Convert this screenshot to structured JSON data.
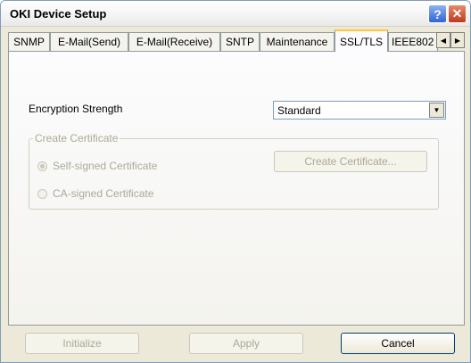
{
  "window": {
    "title": "OKI Device Setup",
    "help_glyph": "?",
    "close_glyph": "✕"
  },
  "tabs": [
    {
      "label": "SNMP",
      "active": false
    },
    {
      "label": "E-Mail(Send)",
      "active": false
    },
    {
      "label": "E-Mail(Receive)",
      "active": false
    },
    {
      "label": "SNTP",
      "active": false
    },
    {
      "label": "Maintenance",
      "active": false
    },
    {
      "label": "SSL/TLS",
      "active": true
    },
    {
      "label": "IEEE802",
      "active": false
    }
  ],
  "tab_scroll": {
    "left_glyph": "◀",
    "right_glyph": "▶"
  },
  "encryption": {
    "label": "Encryption Strength",
    "value": "Standard",
    "arrow_glyph": "▼"
  },
  "create_certificate": {
    "group_label": "Create Certificate",
    "self_signed_label": "Self-signed Certificate",
    "ca_signed_label": "CA-signed Certificate",
    "selected": "self-signed",
    "button_label": "Create Certificate..."
  },
  "footer": {
    "initialize_label": "Initialize",
    "apply_label": "Apply",
    "cancel_label": "Cancel"
  },
  "colors": {
    "active_tab_highlight": "#ffc83c",
    "disabled_text": "#aca899"
  }
}
